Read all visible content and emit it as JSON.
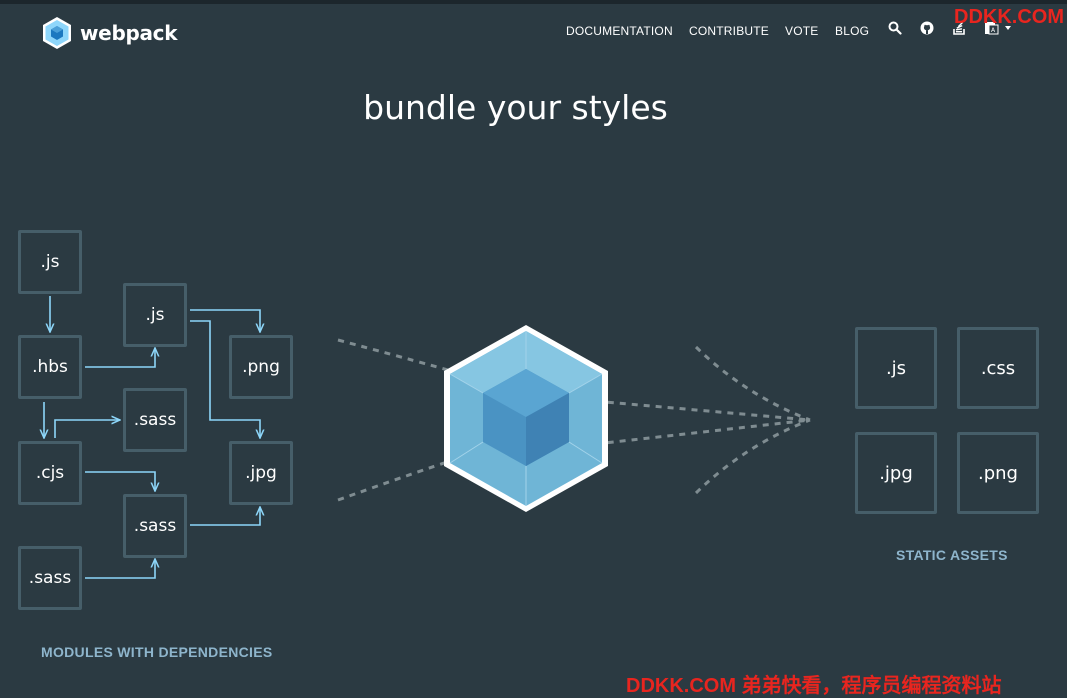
{
  "brand": {
    "name": "webpack",
    "logo_icon": "webpack-cube-icon"
  },
  "nav": {
    "links": [
      "DOCUMENTATION",
      "CONTRIBUTE",
      "VOTE",
      "BLOG"
    ],
    "icons": [
      "search-icon",
      "github-icon",
      "stack-overflow-icon",
      "language-icon"
    ]
  },
  "watermark": {
    "top": "DDKK.COM",
    "bottom": "DDKK.COM 弟弟快看，程序员编程资料站"
  },
  "hero": {
    "title": "bundle your styles"
  },
  "modules": {
    "caption": "MODULES WITH DEPENDENCIES",
    "nodes": [
      ".js",
      ".hbs",
      ".cjs",
      ".sass",
      ".js",
      ".sass",
      ".sass",
      ".png",
      ".jpg"
    ]
  },
  "assets": {
    "caption": "STATIC ASSETS",
    "items": [
      ".js",
      ".css",
      ".jpg",
      ".png"
    ]
  },
  "colors": {
    "background": "#2b3a42",
    "node_border": "#465e69",
    "wire": "#8dd6f9",
    "cube_light": "#8ed6fb",
    "cube_dark": "#1c78c0",
    "caption": "#8eb5cc"
  }
}
